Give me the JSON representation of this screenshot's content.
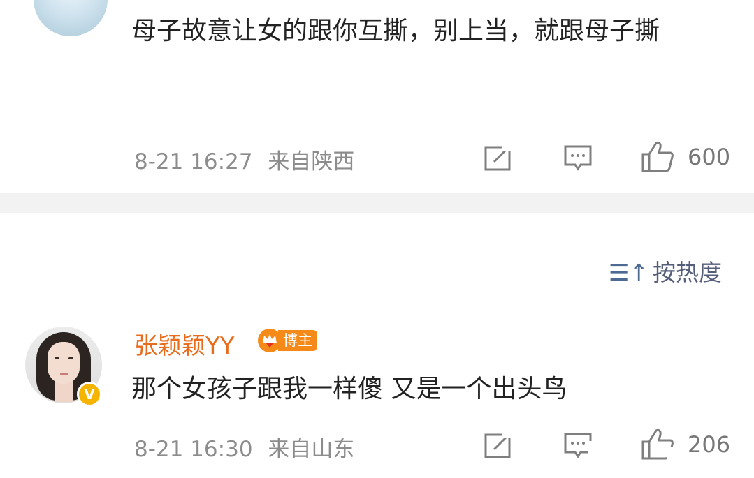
{
  "comments": [
    {
      "text": "母子故意让女的跟你互撕，别上当，就跟母子撕",
      "time": "8-21 16:27",
      "location": "来自陕西",
      "likes": "600"
    },
    {
      "username": "张颖颖YY",
      "badge": "博主",
      "verified_mark": "V",
      "text": "那个女孩子跟我一样傻 又是一个出头鸟",
      "time": "8-21 16:30",
      "location": "来自山东",
      "likes": "206"
    }
  ],
  "sort": {
    "label": "按热度",
    "icon": "sort-icon"
  },
  "colors": {
    "username": "#e86c1c",
    "badge_bg": "#f58a18",
    "verified": "#f5b400",
    "meta": "#8c8c8c",
    "sort": "#555e78"
  },
  "icons": [
    "share-icon",
    "comment-icon",
    "like-icon"
  ]
}
